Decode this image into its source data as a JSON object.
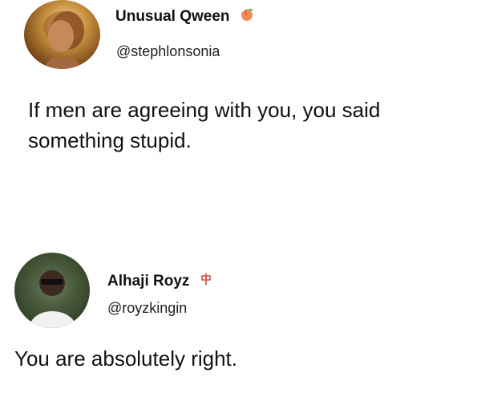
{
  "tweets": [
    {
      "display_name": "Unusual Qween",
      "badge_icon": "peach-icon",
      "handle": "@stephlonsonia",
      "text": "If men are agreeing with you, you said something stupid."
    },
    {
      "display_name": "Alhaji Royz",
      "badge_icon": "symbol-icon",
      "handle": "@royzkingin",
      "text": "You are absolutely right."
    }
  ],
  "colors": {
    "background": "#ffffff",
    "text": "#111111",
    "peach_badge": "#f28b55",
    "symbol_badge": "#d44a4a"
  }
}
